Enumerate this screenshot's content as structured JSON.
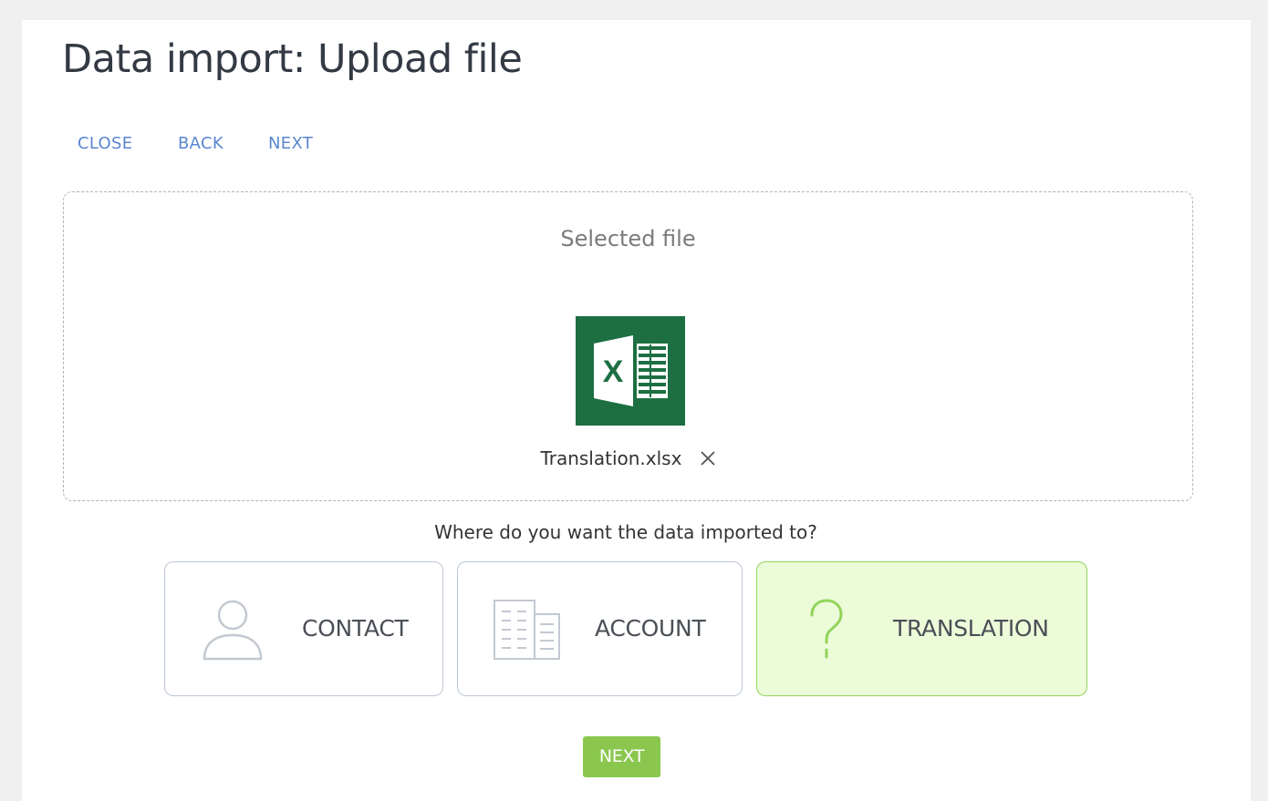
{
  "page": {
    "title": "Data import: Upload file"
  },
  "toolbar": {
    "close_label": "CLOSE",
    "back_label": "BACK",
    "next_label": "NEXT"
  },
  "upload": {
    "selected_label": "Selected file",
    "file_name": "Translation.xlsx",
    "file_icon": "excel-file-icon",
    "remove_icon": "close-icon"
  },
  "destination": {
    "question": "Where do you want the data imported to?",
    "options": [
      {
        "label": "CONTACT",
        "icon": "person-icon",
        "selected": false
      },
      {
        "label": "ACCOUNT",
        "icon": "building-icon",
        "selected": false
      },
      {
        "label": "TRANSLATION",
        "icon": "question-mark-icon",
        "selected": true
      }
    ]
  },
  "footer": {
    "next_label": "NEXT"
  },
  "colors": {
    "link_blue": "#5a86d1",
    "next_button_green": "#8bc74f",
    "selected_card_bg": "#ecfbd8",
    "selected_card_border": "#93d45b",
    "excel_green": "#1d6f42"
  }
}
